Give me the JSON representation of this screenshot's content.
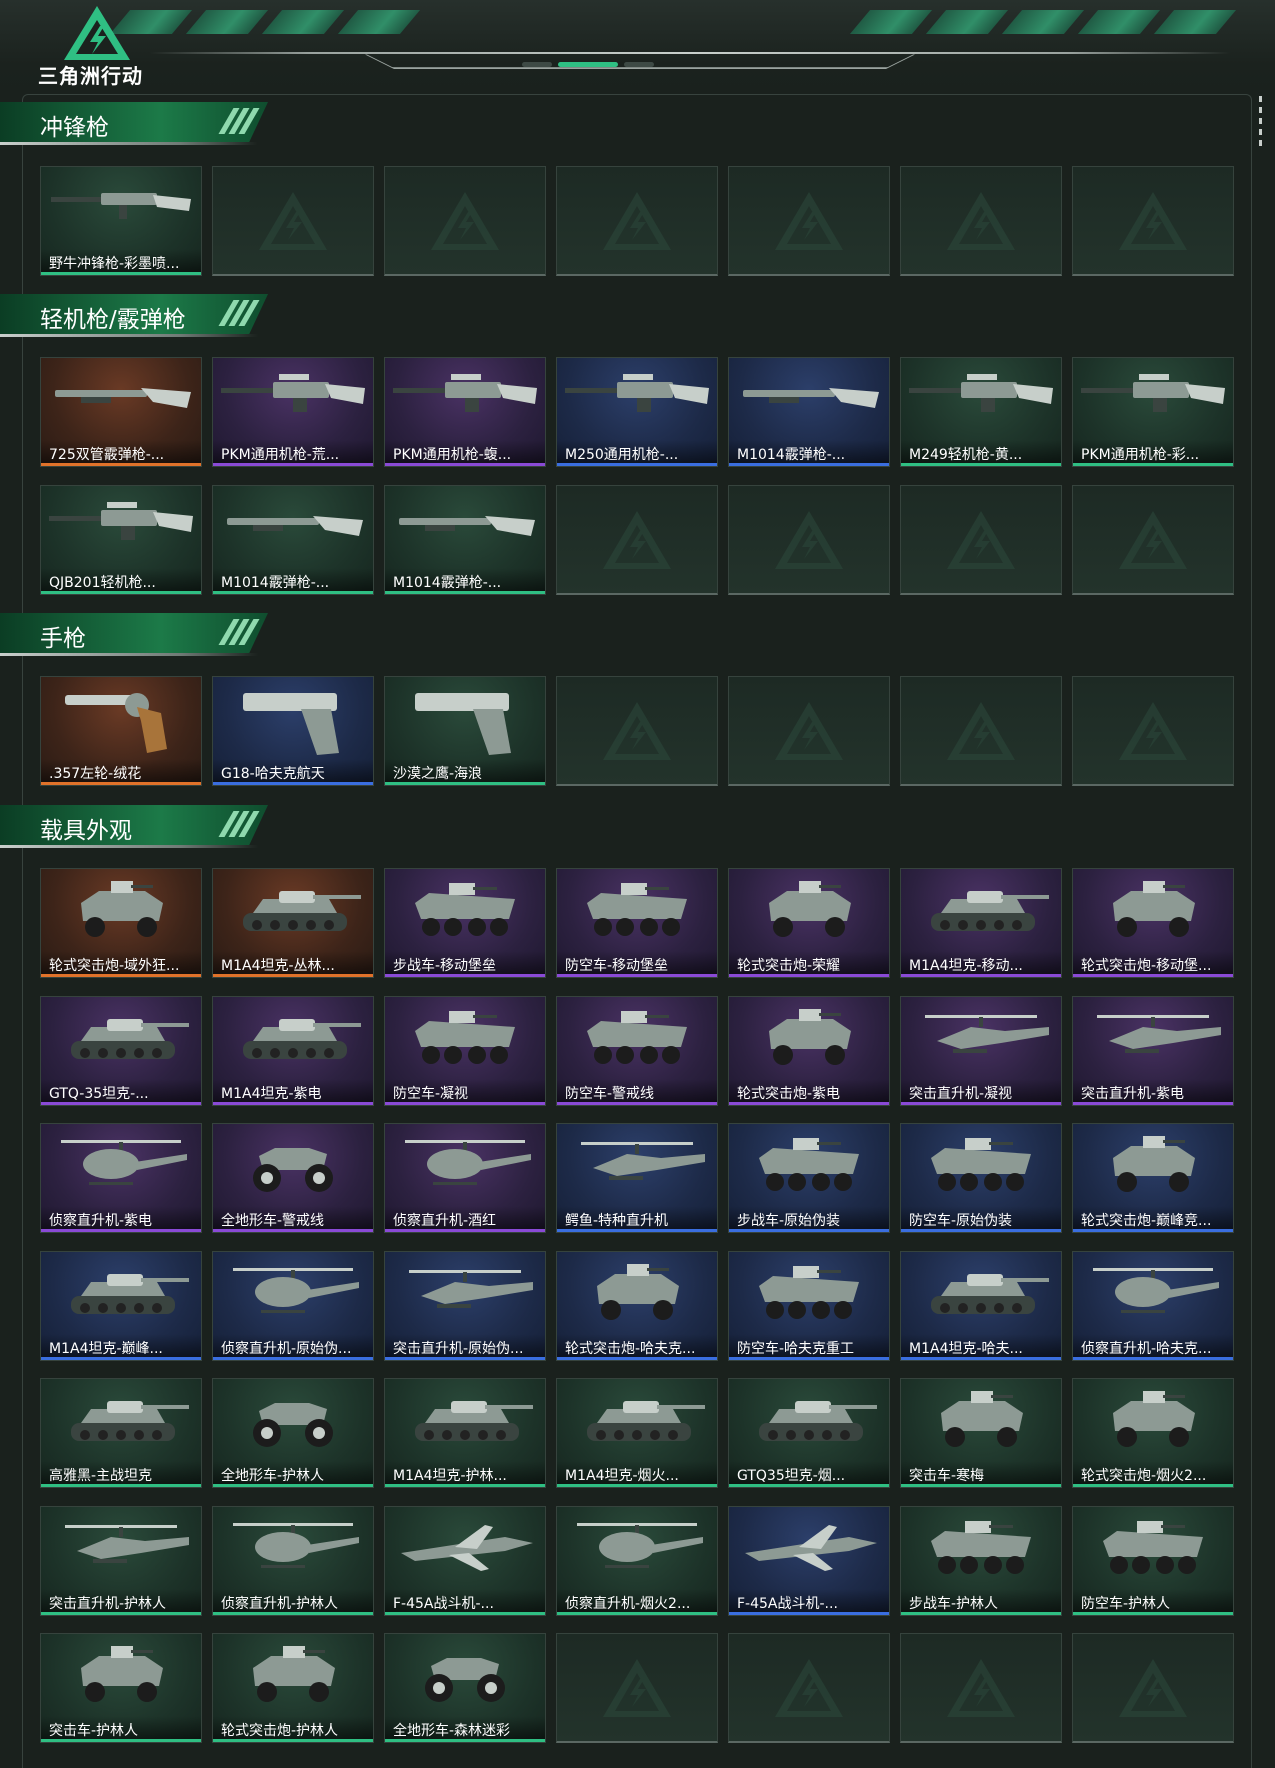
{
  "app": {
    "logo_text": "三角洲行动",
    "accent_color": "#2fbf83"
  },
  "rarity_colors": {
    "orange": "#e0722a",
    "purple": "#8a4ad6",
    "blue": "#3a6ee0",
    "green": "#2fbf83"
  },
  "sections": [
    {
      "title": "冲锋枪",
      "rows": [
        [
          {
            "name": "野牛冲锋枪-彩墨喷...",
            "rarity": "green",
            "icon": "rifle-icon"
          },
          null,
          null,
          null,
          null,
          null,
          null
        ]
      ]
    },
    {
      "title": "轻机枪/霰弹枪",
      "rows": [
        [
          {
            "name": "725双管霰弹枪-...",
            "rarity": "orange",
            "icon": "shotgun-icon"
          },
          {
            "name": "PKM通用机枪-荒...",
            "rarity": "purple",
            "icon": "machine-gun-icon"
          },
          {
            "name": "PKM通用机枪-蝮...",
            "rarity": "purple",
            "icon": "machine-gun-icon"
          },
          {
            "name": "M250通用机枪-...",
            "rarity": "blue",
            "icon": "machine-gun-icon"
          },
          {
            "name": "M1014霰弹枪-...",
            "rarity": "blue",
            "icon": "shotgun-icon"
          },
          {
            "name": "M249轻机枪-黄...",
            "rarity": "green",
            "icon": "machine-gun-icon"
          },
          {
            "name": "PKM通用机枪-彩...",
            "rarity": "green",
            "icon": "machine-gun-icon"
          }
        ],
        [
          {
            "name": "QJB201轻机枪...",
            "rarity": "green",
            "icon": "machine-gun-icon"
          },
          {
            "name": "M1014霰弹枪-...",
            "rarity": "green",
            "icon": "shotgun-icon"
          },
          {
            "name": "M1014霰弹枪-...",
            "rarity": "green",
            "icon": "shotgun-icon"
          },
          null,
          null,
          null,
          null
        ]
      ]
    },
    {
      "title": "手枪",
      "rows": [
        [
          {
            "name": ".357左轮-绒花",
            "rarity": "orange",
            "icon": "revolver-icon"
          },
          {
            "name": "G18-哈夫克航天",
            "rarity": "blue",
            "icon": "pistol-icon"
          },
          {
            "name": "沙漠之鹰-海浪",
            "rarity": "green",
            "icon": "pistol-icon"
          },
          null,
          null,
          null,
          null
        ]
      ]
    },
    {
      "title": "载具外观",
      "rows": [
        [
          {
            "name": "轮式突击炮-域外狂...",
            "rarity": "orange",
            "icon": "armored-car-icon"
          },
          {
            "name": "M1A4坦克-丛林...",
            "rarity": "orange",
            "icon": "tank-icon"
          },
          {
            "name": "步战车-移动堡垒",
            "rarity": "purple",
            "icon": "ifv-icon"
          },
          {
            "name": "防空车-移动堡垒",
            "rarity": "purple",
            "icon": "ifv-icon"
          },
          {
            "name": "轮式突击炮-荣耀",
            "rarity": "purple",
            "icon": "armored-car-icon"
          },
          {
            "name": "M1A4坦克-移动...",
            "rarity": "purple",
            "icon": "tank-icon"
          },
          {
            "name": "轮式突击炮-移动堡...",
            "rarity": "purple",
            "icon": "armored-car-icon"
          }
        ],
        [
          {
            "name": "GTQ-35坦克-...",
            "rarity": "purple",
            "icon": "tank-icon"
          },
          {
            "name": "M1A4坦克-紫电",
            "rarity": "purple",
            "icon": "tank-icon"
          },
          {
            "name": "防空车-凝视",
            "rarity": "purple",
            "icon": "ifv-icon"
          },
          {
            "name": "防空车-警戒线",
            "rarity": "purple",
            "icon": "ifv-icon"
          },
          {
            "name": "轮式突击炮-紫电",
            "rarity": "purple",
            "icon": "armored-car-icon"
          },
          {
            "name": "突击直升机-凝视",
            "rarity": "purple",
            "icon": "attack-helicopter-icon"
          },
          {
            "name": "突击直升机-紫电",
            "rarity": "purple",
            "icon": "attack-helicopter-icon"
          }
        ],
        [
          {
            "name": "侦察直升机-紫电",
            "rarity": "purple",
            "icon": "helicopter-icon"
          },
          {
            "name": "全地形车-警戒线",
            "rarity": "purple",
            "icon": "atv-icon"
          },
          {
            "name": "侦察直升机-酒红",
            "rarity": "purple",
            "icon": "helicopter-icon"
          },
          {
            "name": "鳄鱼-特种直升机",
            "rarity": "blue",
            "icon": "attack-helicopter-icon"
          },
          {
            "name": "步战车-原始伪装",
            "rarity": "blue",
            "icon": "ifv-icon"
          },
          {
            "name": "防空车-原始伪装",
            "rarity": "blue",
            "icon": "ifv-icon"
          },
          {
            "name": "轮式突击炮-巅峰竞...",
            "rarity": "blue",
            "icon": "armored-car-icon"
          }
        ],
        [
          {
            "name": "M1A4坦克-巅峰...",
            "rarity": "blue",
            "icon": "tank-icon"
          },
          {
            "name": "侦察直升机-原始伪...",
            "rarity": "blue",
            "icon": "helicopter-icon"
          },
          {
            "name": "突击直升机-原始伪...",
            "rarity": "blue",
            "icon": "attack-helicopter-icon"
          },
          {
            "name": "轮式突击炮-哈夫克...",
            "rarity": "blue",
            "icon": "armored-car-icon"
          },
          {
            "name": "防空车-哈夫克重工",
            "rarity": "blue",
            "icon": "ifv-icon"
          },
          {
            "name": "M1A4坦克-哈夫...",
            "rarity": "blue",
            "icon": "tank-icon"
          },
          {
            "name": "侦察直升机-哈夫克...",
            "rarity": "blue",
            "icon": "helicopter-icon"
          }
        ],
        [
          {
            "name": "高雅黑-主战坦克",
            "rarity": "green",
            "icon": "tank-icon"
          },
          {
            "name": "全地形车-护林人",
            "rarity": "green",
            "icon": "atv-icon"
          },
          {
            "name": "M1A4坦克-护林...",
            "rarity": "green",
            "icon": "tank-icon"
          },
          {
            "name": "M1A4坦克-烟火...",
            "rarity": "green",
            "icon": "tank-icon"
          },
          {
            "name": "GTQ35坦克-烟...",
            "rarity": "green",
            "icon": "tank-icon"
          },
          {
            "name": "突击车-寒梅",
            "rarity": "green",
            "icon": "armored-car-icon"
          },
          {
            "name": "轮式突击炮-烟火2...",
            "rarity": "green",
            "icon": "armored-car-icon"
          }
        ],
        [
          {
            "name": "突击直升机-护林人",
            "rarity": "green",
            "icon": "attack-helicopter-icon"
          },
          {
            "name": "侦察直升机-护林人",
            "rarity": "green",
            "icon": "helicopter-icon"
          },
          {
            "name": "F-45A战斗机-...",
            "rarity": "green",
            "icon": "jet-icon"
          },
          {
            "name": "侦察直升机-烟火2...",
            "rarity": "green",
            "icon": "helicopter-icon"
          },
          {
            "name": "F-45A战斗机-...",
            "rarity": "blue",
            "icon": "jet-icon"
          },
          {
            "name": "步战车-护林人",
            "rarity": "green",
            "icon": "ifv-icon"
          },
          {
            "name": "防空车-护林人",
            "rarity": "green",
            "icon": "ifv-icon"
          }
        ],
        [
          {
            "name": "突击车-护林人",
            "rarity": "green",
            "icon": "armored-car-icon"
          },
          {
            "name": "轮式突击炮-护林人",
            "rarity": "green",
            "icon": "armored-car-icon"
          },
          {
            "name": "全地形车-森林迷彩",
            "rarity": "green",
            "icon": "atv-icon"
          },
          null,
          null,
          null,
          null
        ]
      ]
    }
  ]
}
